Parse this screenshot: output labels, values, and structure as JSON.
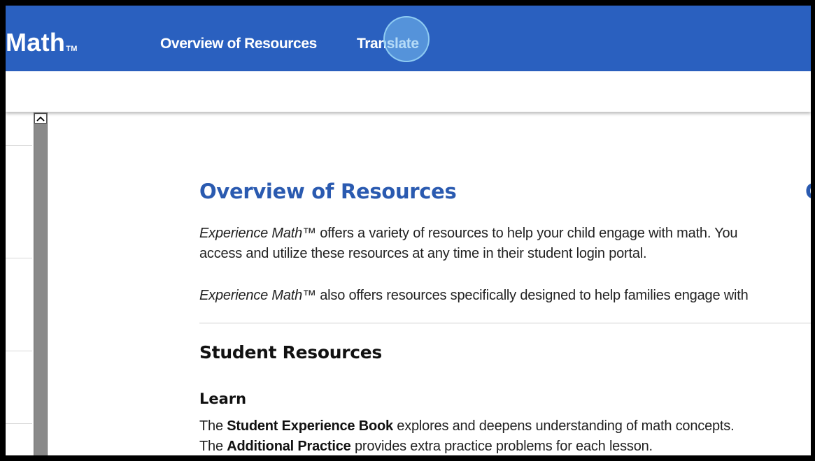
{
  "nav": {
    "brand": "Math",
    "brand_tm": "TM",
    "links": [
      "Overview of Resources",
      "Translate"
    ]
  },
  "content": {
    "title": "Overview of Resources",
    "title_edge_char": "C",
    "intro_1_em": "Experience Math™",
    "intro_1_a": " offers a variety of resources to help your child engage with math. You",
    "intro_1_b": "access and utilize these resources at any time in their student login portal.",
    "intro_2_em": "Experience Math™",
    "intro_2_a": " also offers resources specifically designed to help families engage with",
    "section_title": "Student Resources",
    "sub_title": "Learn",
    "learn_line1_pre": "The ",
    "learn_line1_bold": "Student Experience Book",
    "learn_line1_post": " explores and deepens understanding of math concepts.",
    "learn_line2_pre": "The ",
    "learn_line2_bold": "Additional Practice",
    "learn_line2_post": " provides extra practice problems for each lesson."
  },
  "colors": {
    "nav_bg": "#2a60bf",
    "title": "#2a5ab0"
  },
  "icons": {
    "scroll_up": "chevron-up-icon"
  }
}
